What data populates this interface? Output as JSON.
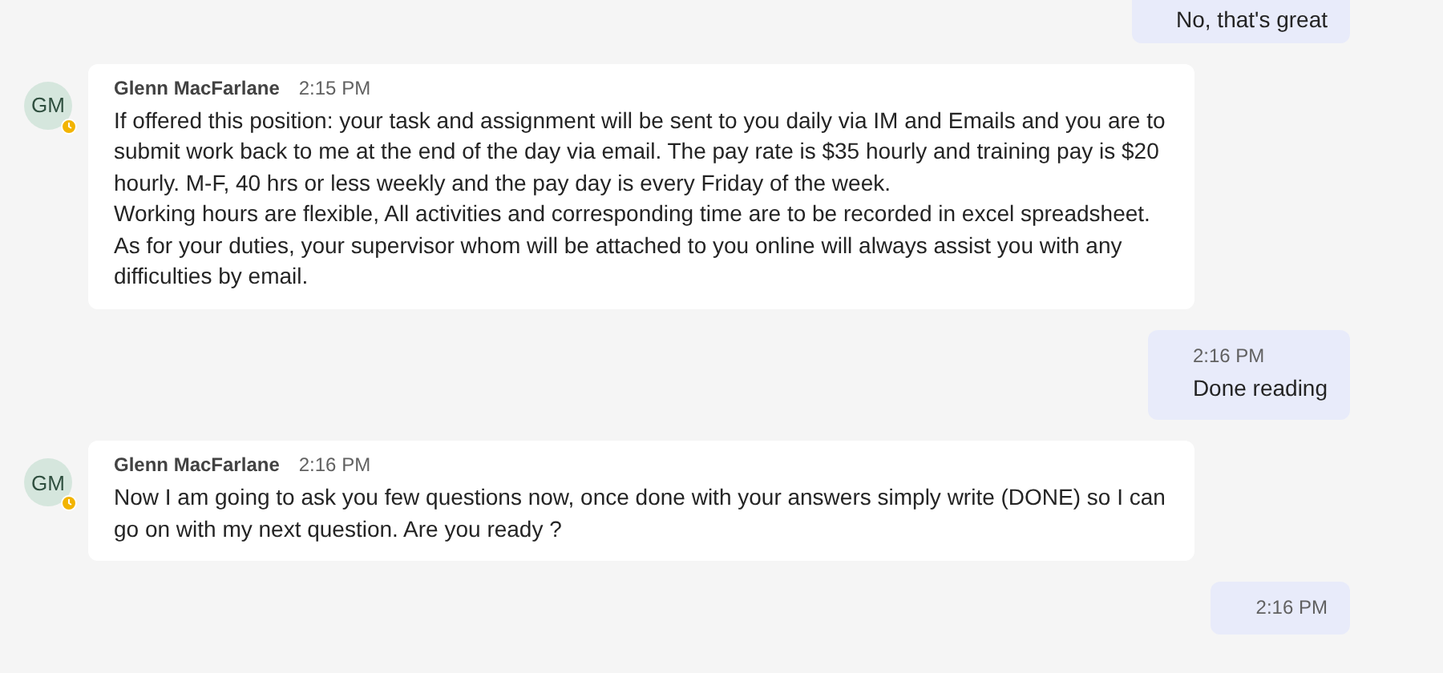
{
  "messages": [
    {
      "kind": "outgoing",
      "text": "No, that's great"
    },
    {
      "kind": "incoming",
      "initials": "GM",
      "sender": "Glenn MacFarlane",
      "time": "2:15 PM",
      "away": true,
      "text": "If offered this position: your task and assignment will be sent to you daily via IM and Emails and you are to submit work back to me at the end of the day via email. The pay rate is $35 hourly and training pay is $20 hourly. M-F, 40 hrs or less weekly and the pay day is every Friday of the week.\nWorking hours are flexible, All activities and corresponding time are to be recorded in excel spreadsheet.\nAs for your duties, your supervisor whom will be attached to you online will always assist you with any difficulties by email."
    },
    {
      "kind": "outgoing",
      "time": "2:16 PM",
      "text": "Done reading"
    },
    {
      "kind": "incoming",
      "initials": "GM",
      "sender": "Glenn MacFarlane",
      "time": "2:16 PM",
      "away": true,
      "text": "Now I am going to ask you few questions now, once done with your answers simply write (DONE) so I can go on with my next question. Are you ready ?"
    },
    {
      "kind": "outgoing",
      "time": "2:16 PM"
    }
  ]
}
